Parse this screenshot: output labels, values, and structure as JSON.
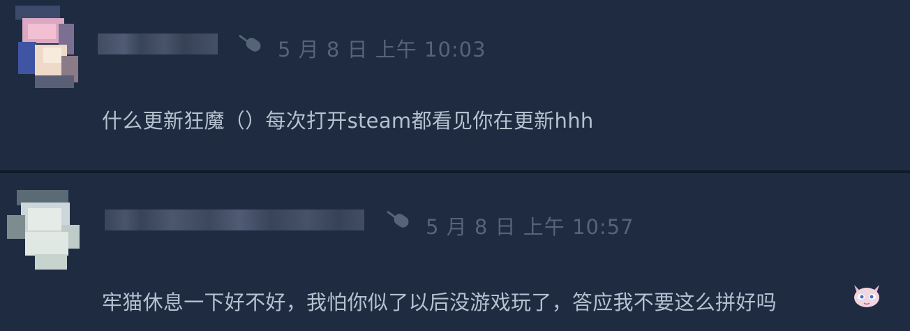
{
  "comments": [
    {
      "avatar": "blurred-avatar-pink",
      "username": "",
      "device_icon": "mouse-icon",
      "timestamp": "5 月 8 日 上午 10:03",
      "text": "什么更新狂魔（）每次打开steam都看见你在更新hhh"
    },
    {
      "avatar": "blurred-avatar-pale",
      "username": "",
      "device_icon": "mouse-icon",
      "timestamp": "5 月 8 日 上午 10:57",
      "text": "牢猫休息一下好不好，我怕你似了以后没游戏玩了，答应我不要这么拼好吗",
      "emoji": "cat-face-emoji"
    }
  ],
  "colors": {
    "background": "#1e2b41",
    "divider": "#111a28",
    "text": "#b6c1cf",
    "timestamp": "#566478"
  }
}
